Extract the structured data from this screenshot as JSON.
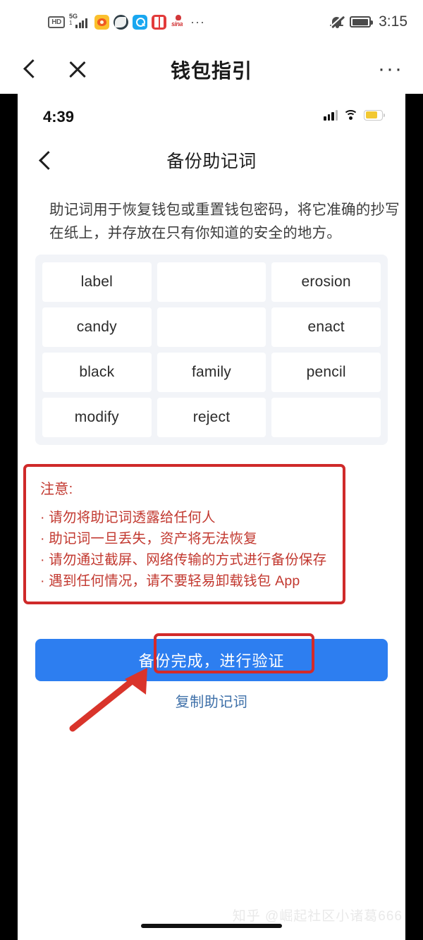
{
  "android_status": {
    "icons": [
      "hd-badge-icon",
      "signal-5g-icon",
      "weibo-app-icon",
      "globe-app-icon",
      "search-app-icon",
      "book-app-icon",
      "sina-app-icon"
    ],
    "hd_label": "HD",
    "network_label": "5G",
    "network_sub": "1",
    "overflow": "···",
    "clock": "3:15"
  },
  "app_nav": {
    "title": "钱包指引",
    "back_icon": "chevron-left-icon",
    "close_icon": "close-icon",
    "more": "···"
  },
  "inner": {
    "status": {
      "time": "4:39"
    },
    "header": {
      "title": "备份助记词",
      "back_icon": "chevron-left-icon"
    },
    "description": "助记词用于恢复钱包或重置钱包密码，将它准确的抄写在纸上，并存放在只有你知道的安全的地方。",
    "mnemonic_words": [
      "label",
      "",
      "erosion",
      "candy",
      "",
      "enact",
      "black",
      "family",
      "pencil",
      "modify",
      "reject",
      ""
    ],
    "warning": {
      "title": "注意:",
      "lines": [
        "· 请勿将助记词透露给任何人",
        "· 助记词一旦丢失，资产将无法恢复",
        "· 请勿通过截屏、网络传输的方式进行备份保存",
        "· 遇到任何情况，请不要轻易卸载钱包 App"
      ]
    },
    "cta_label": "备份完成，进行验证",
    "copy_link_label": "复制助记词"
  },
  "watermark": "知乎 @崛起社区小诸葛666",
  "colors": {
    "cta_blue": "#2d7ef0",
    "annotation_red": "#d32a2a",
    "warning_red": "#c2382f",
    "link_blue": "#3d6fa8",
    "grid_bg": "#f2f4f8"
  }
}
